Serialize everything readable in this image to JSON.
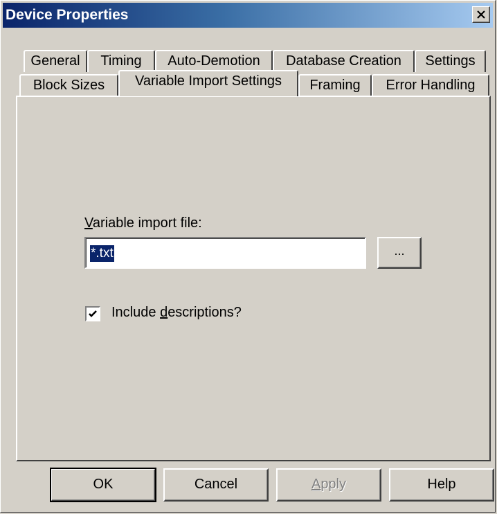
{
  "window": {
    "title": "Device Properties",
    "close_label": "×"
  },
  "tabs": {
    "row1": [
      "General",
      "Timing",
      "Auto-Demotion",
      "Database Creation",
      "Settings"
    ],
    "row2": [
      "Block Sizes",
      "Variable Import Settings",
      "Framing",
      "Error Handling"
    ],
    "active": "Variable Import Settings"
  },
  "form": {
    "import_label_mnemonic": "V",
    "import_label_rest": "ariable import file:",
    "import_file_value": "*.txt",
    "browse_label": "...",
    "include_label_pre": "Include ",
    "include_label_mnemonic": "d",
    "include_label_post": "escriptions?",
    "include_descriptions": true
  },
  "buttons": {
    "ok": "OK",
    "cancel": "Cancel",
    "apply": "Apply",
    "help": "Help"
  }
}
